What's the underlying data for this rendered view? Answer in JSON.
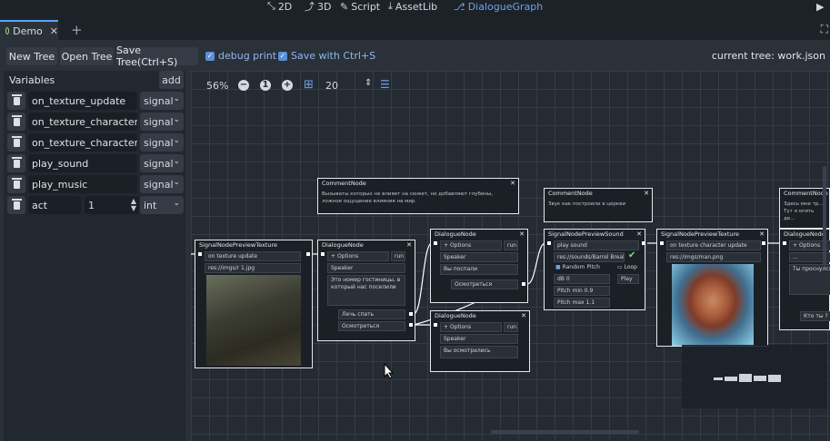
{
  "topbar": {
    "modes": [
      {
        "label": "2D",
        "icon": "2d-icon"
      },
      {
        "label": "3D",
        "icon": "3d-icon"
      },
      {
        "label": "Script",
        "icon": "script-icon"
      },
      {
        "label": "AssetLib",
        "icon": "assetlib-icon"
      },
      {
        "label": "DialogueGraph",
        "icon": "dialoguegraph-icon",
        "active": true
      }
    ]
  },
  "tabs": [
    {
      "label": "Demo"
    }
  ],
  "toolbar": {
    "new_tree": "New Tree",
    "open_tree": "Open Tree",
    "save_tree": "Save Tree(Ctrl+S)",
    "debug_print": "debug print",
    "save_ctrl_s": "Save with Ctrl+S",
    "current_tree": "current tree: work.json"
  },
  "variables": {
    "title": "Variables",
    "add": "add",
    "items": [
      {
        "name": "on_texture_update",
        "type": "signal"
      },
      {
        "name": "on_texture_character_u",
        "type": "signal"
      },
      {
        "name": "on_texture_character_h",
        "type": "signal"
      },
      {
        "name": "play_sound",
        "type": "signal"
      },
      {
        "name": "play_music",
        "type": "signal"
      },
      {
        "name": "act",
        "value": "1",
        "type": "int"
      }
    ]
  },
  "graph_toolbar": {
    "zoom": "56%",
    "snap": "20"
  },
  "nodes": {
    "comment1": {
      "title": "CommentNode",
      "text": "Вызываты которых не влияет на сюжет, но добавляют глубины, ложное ощущение влияния на мир."
    },
    "comment2": {
      "title": "CommentNode",
      "text": "Звук как построили в церкви"
    },
    "comment3": {
      "title": "CommentNode",
      "text": "Здесь мне тр... Тут я опять де..."
    },
    "preview_texture": {
      "title": "SignalNodePreviewTexture",
      "signal": "on texture update",
      "path": "res://imgs/r 1.jpg"
    },
    "dialogue1": {
      "title": "DialogueNode",
      "options": "Options",
      "run": "run",
      "speaker": "Speaker",
      "text": "Это номер гостиницы, в который нас поселили",
      "opt1": "Лечь спать",
      "opt2": "Осмотреться"
    },
    "dialogue2": {
      "title": "DialogueNode",
      "options": "Options",
      "run": "run",
      "speaker": "Speaker",
      "text": "Вы поспали",
      "opt1": "Осмотреться"
    },
    "dialogue3": {
      "title": "DialogueNode",
      "options": "Options",
      "run": "run",
      "speaker": "Speaker",
      "text": "Вы осмотрелись"
    },
    "preview_sound": {
      "title": "SignalNodePreviewSound",
      "signal": "play sound",
      "path": "res://sounds/Barrel Break_",
      "random_pitch": "Random Pitch",
      "loop": "Loop",
      "db": "dB 0",
      "play": "Play",
      "pitch_min": "Pitch min 0.9",
      "pitch_max": "Pitch max 1.1"
    },
    "preview_texture2": {
      "title": "SignalNodePreviewTexture",
      "signal": "on texture character update",
      "path": "res://imgs/man.png"
    },
    "dialogue4": {
      "title": "DialogueNode",
      "options": "Options",
      "speaker": "...",
      "text": "Ты проснулся?",
      "opt1": "Кто ты ?"
    }
  }
}
